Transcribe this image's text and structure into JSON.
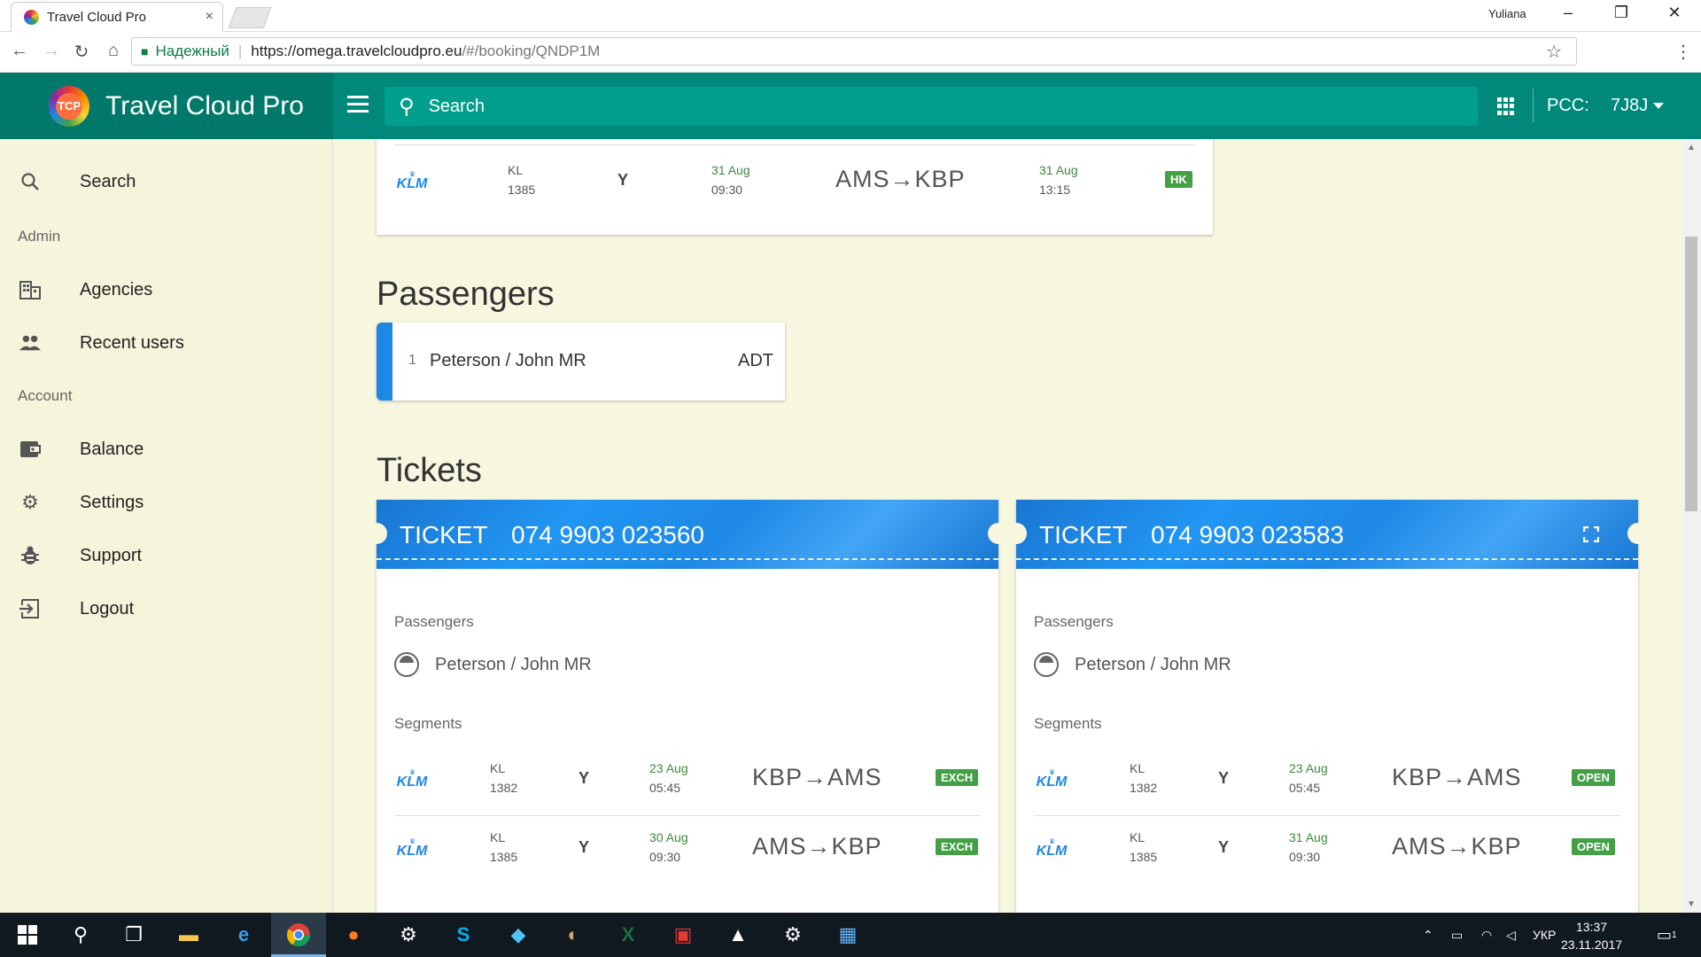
{
  "browser": {
    "tab_title": "Travel Cloud Pro",
    "tab_close": "×",
    "window_user": "Yuliana",
    "secure_label": "Надежный",
    "url_host": "https://omega.travelcloudpro.eu",
    "url_path": "/#/booking/QNDP1M"
  },
  "header": {
    "logo_text": "TCP",
    "brand": "Travel Cloud Pro",
    "search_placeholder": "Search",
    "pcc_label": "PCC:",
    "pcc_value": "7J8J"
  },
  "sidebar": {
    "items": [
      {
        "label": "Search",
        "icon": "search-icon"
      },
      {
        "label": "Agencies",
        "icon": "building-icon"
      },
      {
        "label": "Recent users",
        "icon": "people-icon"
      },
      {
        "label": "Balance",
        "icon": "wallet-icon"
      },
      {
        "label": "Settings",
        "icon": "gear-icon"
      },
      {
        "label": "Support",
        "icon": "bug-icon"
      },
      {
        "label": "Logout",
        "icon": "logout-icon"
      }
    ],
    "headings": [
      "Admin",
      "Account"
    ]
  },
  "top_segment": {
    "airline_logo": "KLM",
    "carrier": "KL",
    "flight": "1385",
    "class": "Y",
    "dep_date": "31 Aug",
    "dep_time": "09:30",
    "route": "AMS→KBP",
    "arr_date": "31 Aug",
    "arr_time": "13:15",
    "status": "HK"
  },
  "passengers_section": {
    "title": "Passengers",
    "items": [
      {
        "index": "1",
        "name": "Peterson / John MR",
        "type": "ADT"
      }
    ]
  },
  "tickets_section": {
    "title": "Tickets",
    "passengers_label": "Passengers",
    "segments_label": "Segments",
    "ticket_label": "TICKET",
    "tickets": [
      {
        "number": "074 9903 023560",
        "passenger": "Peterson / John MR",
        "segments": [
          {
            "logo": "KLM",
            "carrier": "KL",
            "flight": "1382",
            "class": "Y",
            "date": "23 Aug",
            "time": "05:45",
            "route": "KBP→AMS",
            "status": "EXCH"
          },
          {
            "logo": "KLM",
            "carrier": "KL",
            "flight": "1385",
            "class": "Y",
            "date": "30 Aug",
            "time": "09:30",
            "route": "AMS→KBP",
            "status": "EXCH"
          }
        ]
      },
      {
        "number": "074 9903 023583",
        "passenger": "Peterson / John MR",
        "segments": [
          {
            "logo": "KLM",
            "carrier": "KL",
            "flight": "1382",
            "class": "Y",
            "date": "23 Aug",
            "time": "05:45",
            "route": "KBP→AMS",
            "status": "OPEN"
          },
          {
            "logo": "KLM",
            "carrier": "KL",
            "flight": "1385",
            "class": "Y",
            "date": "31 Aug",
            "time": "09:30",
            "route": "AMS→KBP",
            "status": "OPEN"
          }
        ]
      }
    ]
  },
  "taskbar": {
    "language": "УКР",
    "time": "13:37",
    "date": "23.11.2017",
    "notification_count": "1"
  },
  "colors": {
    "header": "#00897b",
    "brand_bg": "#00796b",
    "ticket_blue": "#1e88e5",
    "status_green": "#43a047",
    "passenger_accent": "#1e88e5"
  }
}
